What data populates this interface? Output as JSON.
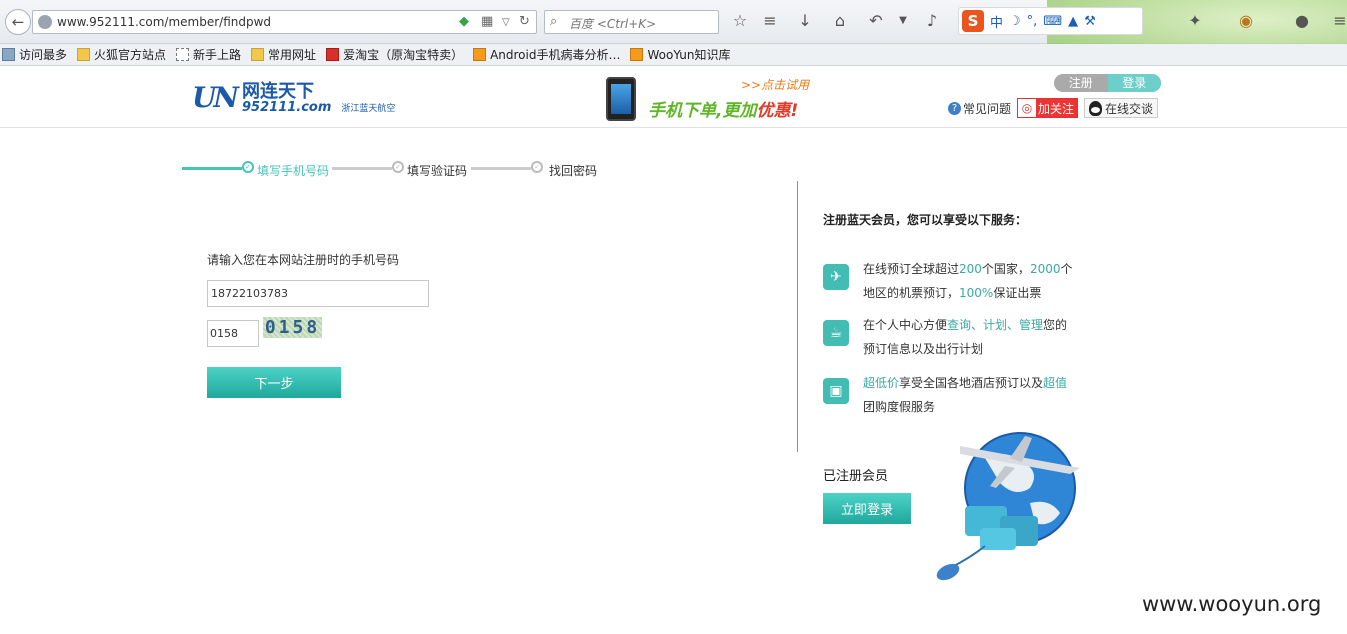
{
  "browser": {
    "url": "www.952111.com/member/findpwd",
    "search_placeholder": "百度 <Ctrl+K>",
    "sogou_label": "中"
  },
  "bookmarks": [
    {
      "label": "访问最多",
      "icon": "gear-icon"
    },
    {
      "label": "火狐官方站点",
      "icon": "folder-icon"
    },
    {
      "label": "新手上路",
      "icon": "page-icon"
    },
    {
      "label": "常用网址",
      "icon": "folder-icon"
    },
    {
      "label": "爱淘宝（原淘宝特卖）",
      "icon": "taobao-icon"
    },
    {
      "label": "Android手机病毒分析…",
      "icon": "rss-icon"
    },
    {
      "label": "WooYun知识库",
      "icon": "rss-icon"
    }
  ],
  "header": {
    "logo_mark": "UN",
    "logo_cn": "网连天下",
    "logo_num": "952111.com",
    "logo_sub": "浙江蓝天航空",
    "banner_try": ">>点击试用",
    "banner_slogan_a": "手机下单,更加",
    "banner_slogan_b": "优惠!",
    "register_label": "注册",
    "login_label": "登录",
    "faq_label": "常见问题",
    "weibo_label": "加关注",
    "qq_label": "在线交谈"
  },
  "steps": [
    {
      "label": "填写手机号码",
      "active": true
    },
    {
      "label": "填写验证码",
      "active": false
    },
    {
      "label": "找回密码",
      "active": false
    }
  ],
  "form": {
    "prompt": "请输入您在本网站注册时的手机号码",
    "phone_value": "18722103783",
    "code_value": "0158",
    "captcha_text": "0158",
    "next_label": "下一步"
  },
  "benefits": {
    "title": "注册蓝天会员，您可以享受以下服务：",
    "items": [
      {
        "icon": "airplane-icon",
        "parts": [
          "在线预订全球超过",
          "200",
          "个国家，",
          "2000",
          "个地区的机票预订，",
          "100%",
          "保证出票"
        ]
      },
      {
        "icon": "coffee-cup-icon",
        "parts": [
          "在个人中心方便",
          "查询、计划、管理",
          "您的预订信息以及出行计划"
        ]
      },
      {
        "icon": "briefcase-icon",
        "parts": [
          "",
          "超低价",
          "享受全国各地酒店预订以及",
          "超值",
          "团购度假服务"
        ]
      }
    ]
  },
  "member": {
    "title": "已注册会员",
    "login_button": "立即登录"
  },
  "watermark": "www.wooyun.org"
}
